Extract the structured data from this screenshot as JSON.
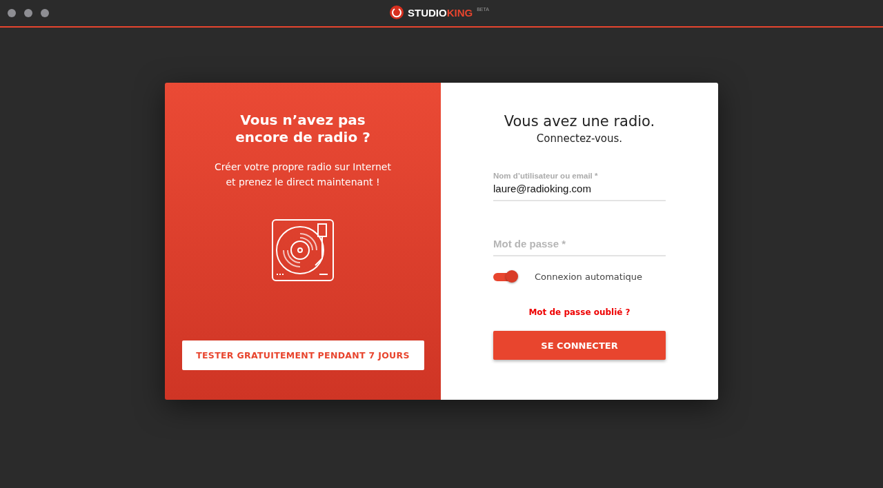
{
  "window": {
    "logo": {
      "primary": "STUDIO",
      "accent": "KING",
      "badge": "BETA"
    }
  },
  "promo": {
    "title_lines": [
      "Vous n’avez pas",
      "encore de radio ?"
    ],
    "text_lines": [
      "Créer votre propre radio sur Internet",
      "et prenez le direct maintenant !"
    ],
    "button": "TESTER GRATUITEMENT PENDANT 7 JOURS"
  },
  "login": {
    "title": "Vous avez une radio.",
    "subtitle": "Connectez-vous.",
    "fields": [
      {
        "label": "Nom d’utilisateur ou email *",
        "value": "laure@radioking.com"
      },
      {
        "placeholder": "Mot de passe *"
      }
    ],
    "auto_login": {
      "label": "Connexion automatique",
      "on": true
    },
    "forgot_link": "Mot de passe oublié ?",
    "submit": "SE CONNECTER"
  }
}
